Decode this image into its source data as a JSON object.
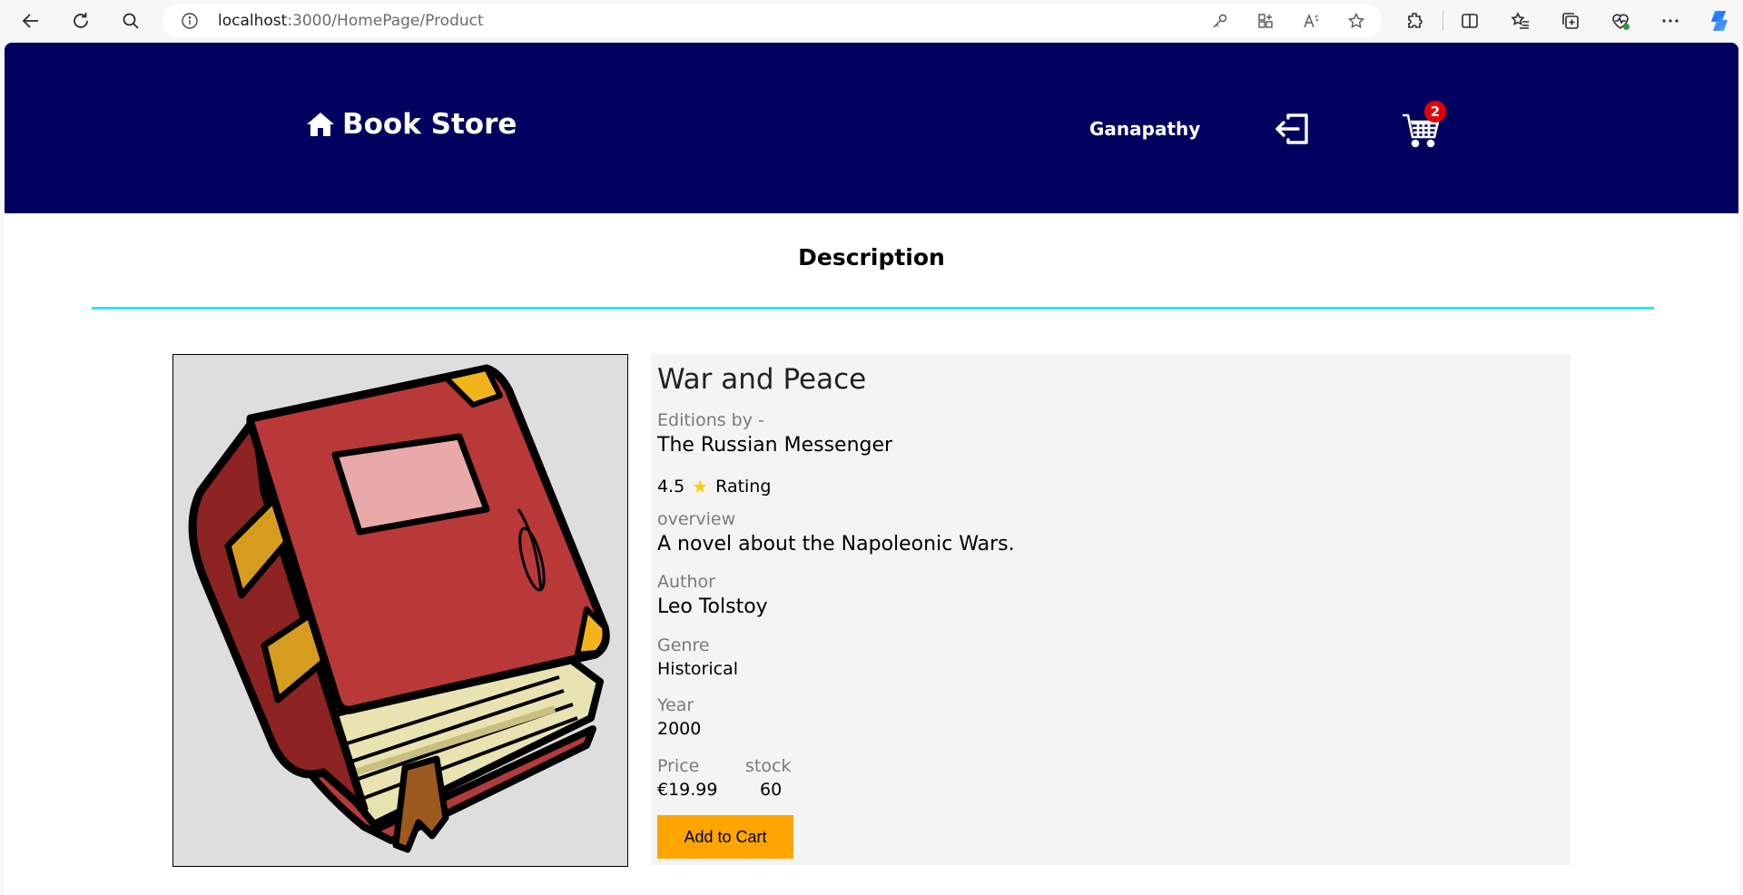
{
  "browser": {
    "url_host": "localhost",
    "url_rest": ":3000/HomePage/Product"
  },
  "navbar": {
    "brand": "Book Store",
    "username": "Ganapathy",
    "cart_count": "2"
  },
  "section_title": "Description",
  "product": {
    "title": "War and Peace",
    "editions_label": "Editions by -",
    "publisher": "The Russian Messenger",
    "rating_value": "4.5",
    "rating_label": "Rating",
    "overview_label": "overview",
    "overview": "A novel about the Napoleonic Wars.",
    "author_label": "Author",
    "author": "Leo Tolstoy",
    "genre_label": "Genre",
    "genre": "Historical",
    "year_label": "Year",
    "year": "2000",
    "price_label": "Price",
    "price": "€19.99",
    "stock_label": "stock",
    "stock": "60",
    "add_to_cart_label": "Add to Cart"
  },
  "colors": {
    "navbar_bg": "#00005e",
    "divider": "#1ef0f0",
    "button_bg": "#ffa500",
    "badge": "#e50000"
  }
}
